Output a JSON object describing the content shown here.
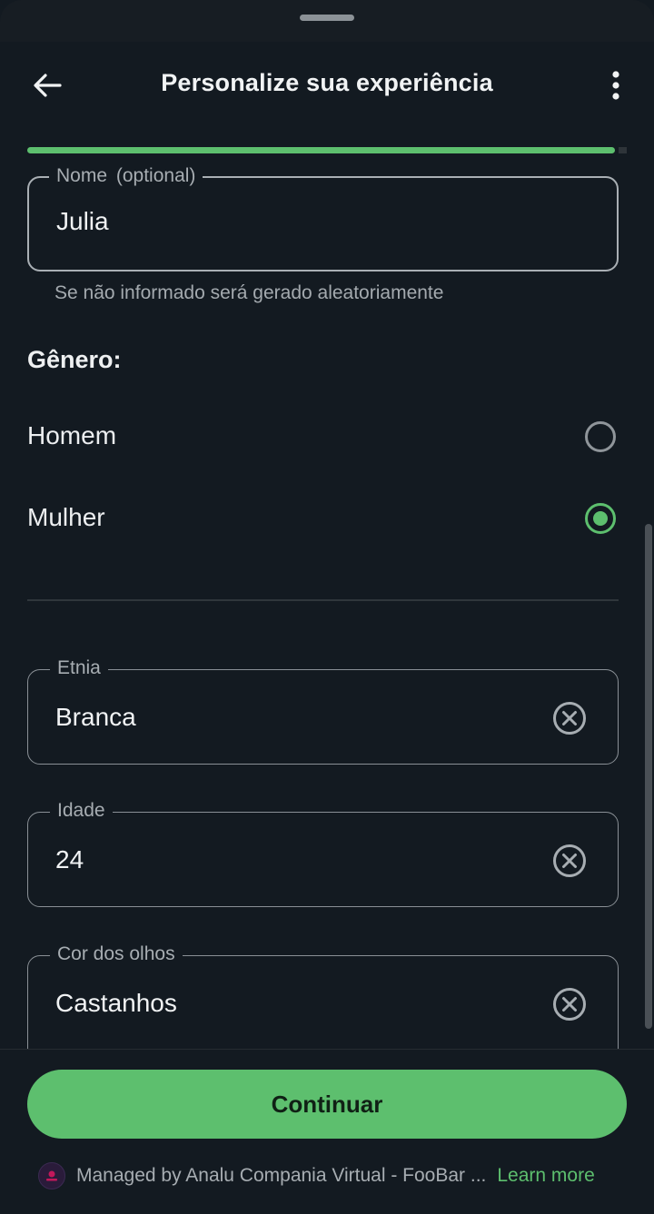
{
  "header": {
    "title": "Personalize sua experiência"
  },
  "progress": {
    "value_percent": 98
  },
  "name_field": {
    "label": "Nome",
    "optional": "(optional)",
    "value": "Julia",
    "helper": "Se não informado será gerado aleatoriamente"
  },
  "gender": {
    "label": "Gênero:",
    "options": [
      {
        "label": "Homem",
        "selected": false
      },
      {
        "label": "Mulher",
        "selected": true
      }
    ]
  },
  "fields": {
    "ethnicity": {
      "label": "Etnia",
      "value": "Branca"
    },
    "age": {
      "label": "Idade",
      "value": "24"
    },
    "eye_color": {
      "label": "Cor dos olhos",
      "value": "Castanhos"
    }
  },
  "footer": {
    "continue_label": "Continuar",
    "managed_text": "Managed by Analu Compania Virtual - FooBar ...",
    "learn_more": "Learn more"
  },
  "colors": {
    "accent": "#5dbf6e",
    "background": "#131a21",
    "outline": "#8a9096"
  },
  "icons": {
    "back": "arrow-left-icon",
    "menu": "more-vertical-icon",
    "clear": "clear-circle-icon"
  }
}
